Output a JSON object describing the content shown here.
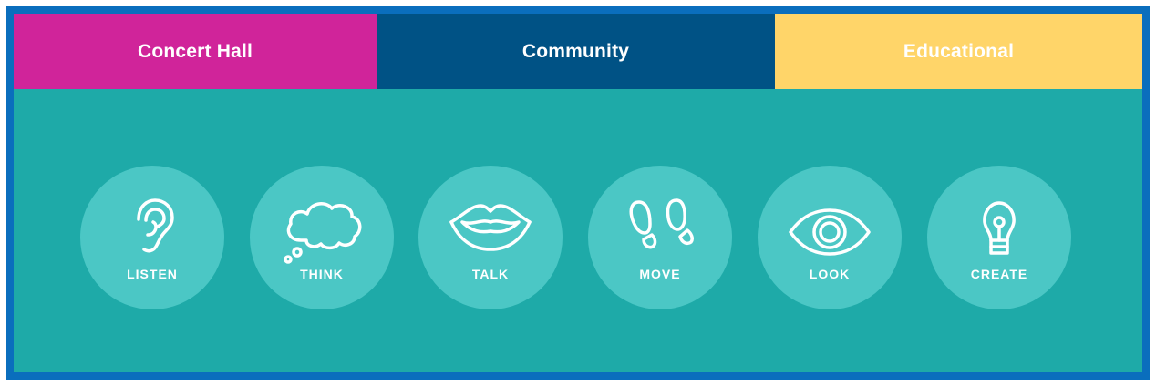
{
  "tabs": [
    {
      "label": "Concert Hall",
      "color": "#d0249a"
    },
    {
      "label": "Community",
      "color": "#005285"
    },
    {
      "label": "Educational",
      "color": "#ffd569"
    }
  ],
  "activities": [
    {
      "label": "LISTEN",
      "icon": "ear-icon"
    },
    {
      "label": "THINK",
      "icon": "thought-cloud-icon"
    },
    {
      "label": "TALK",
      "icon": "lips-icon"
    },
    {
      "label": "MOVE",
      "icon": "footprints-icon"
    },
    {
      "label": "LOOK",
      "icon": "eye-icon"
    },
    {
      "label": "CREATE",
      "icon": "lightbulb-icon"
    }
  ],
  "colors": {
    "border": "#0a6ebd",
    "panel": "#1eaaa8",
    "circle": "#4bc7c5"
  }
}
